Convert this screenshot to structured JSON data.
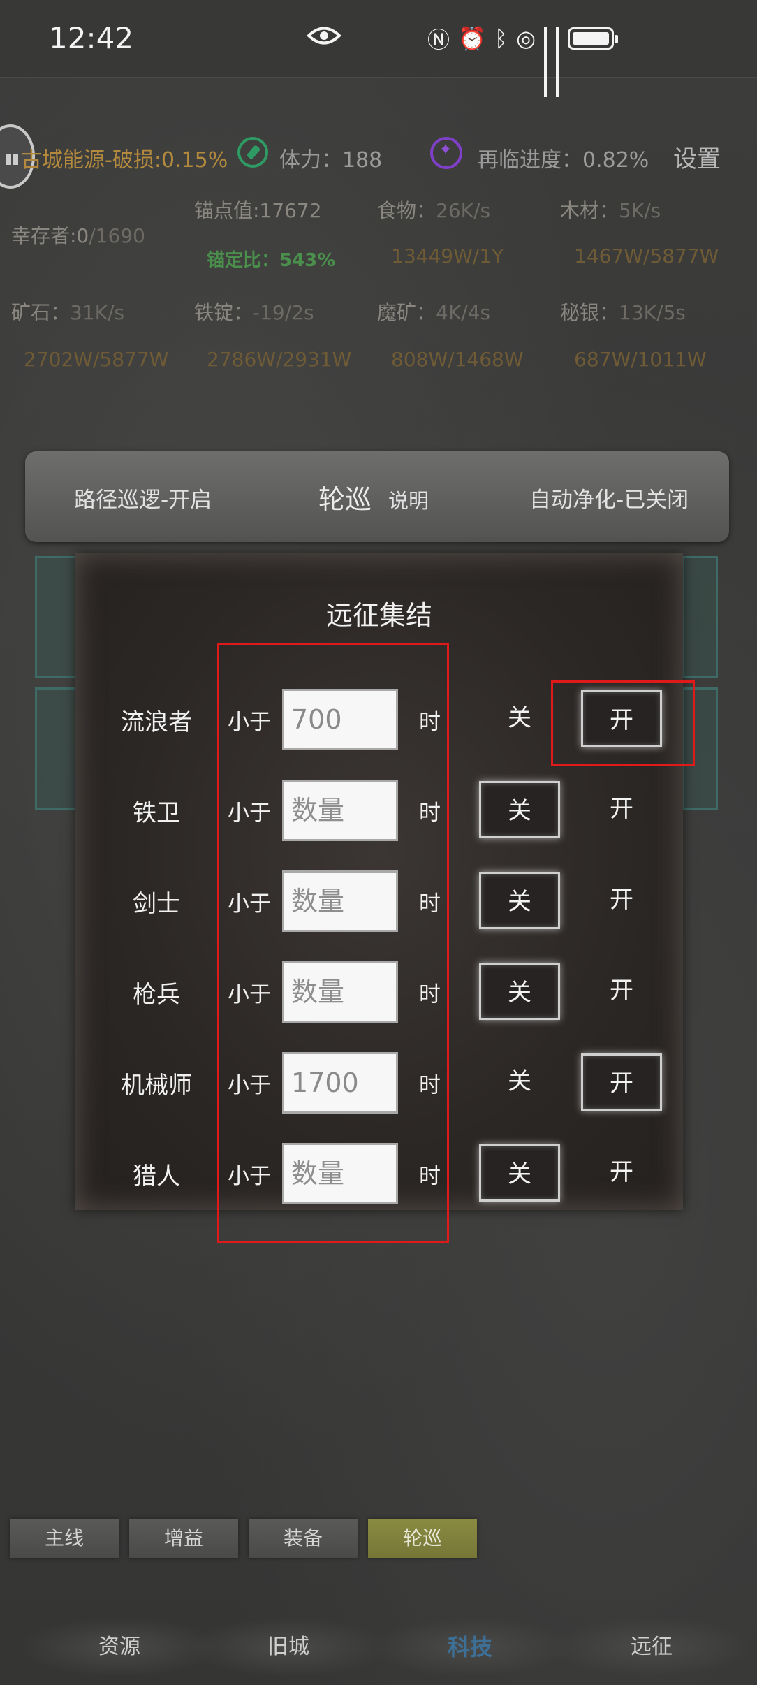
{
  "status_bar": {
    "time": "12:42",
    "icons": [
      "eye-icon",
      "nfc-icon",
      "alarm-icon",
      "bluetooth-icon",
      "hotspot-icon",
      "signal-icon",
      "signal-icon",
      "battery-icon"
    ]
  },
  "stats": {
    "energy": "古城能源-破损:0.15%",
    "stamina_label": "体力：",
    "stamina_value": "188",
    "progress_label": "再临进度：",
    "progress_value": "0.82%",
    "settings": "设置",
    "survivors_label": "幸存者:0",
    "survivors_max": "/1690",
    "anchor": "锚点值:17672",
    "anchor_ratio": "锚定比：543%",
    "food_label": "食物：",
    "food_rate": "26K/s",
    "food_total": "13449W/1Y",
    "wood_label": "木材：",
    "wood_rate": "5K/s",
    "wood_total": "1467W/5877W",
    "ore_label": "矿石：",
    "ore_rate": "31K/s",
    "ore_total": "2702W/5877W",
    "ingot_label": "铁锭：",
    "ingot_rate": "-19/2s",
    "ingot_total": "2786W/2931W",
    "magic_label": "魔矿：",
    "magic_rate": "4K/4s",
    "magic_total": "808W/1468W",
    "mithril_label": "秘银：",
    "mithril_rate": "13K/5s",
    "mithril_total": "687W/1011W"
  },
  "patrol_bar": {
    "path": "路径巡逻-开启",
    "title": "轮巡",
    "help": "说明",
    "auto_purify": "自动净化-已关闭"
  },
  "dialog": {
    "title": "远征集结",
    "less_than": "小于",
    "when": "时",
    "off_label": "关",
    "on_label": "开",
    "placeholder": "数量",
    "rows": [
      {
        "unit": "流浪者",
        "value": "700",
        "state": "on"
      },
      {
        "unit": "铁卫",
        "value": "",
        "state": "off"
      },
      {
        "unit": "剑士",
        "value": "",
        "state": "off"
      },
      {
        "unit": "枪兵",
        "value": "",
        "state": "off"
      },
      {
        "unit": "机械师",
        "value": "1700",
        "state": "on"
      },
      {
        "unit": "猎人",
        "value": "",
        "state": "off"
      }
    ]
  },
  "sub_tabs": [
    "主线",
    "增益",
    "装备",
    "轮巡"
  ],
  "sub_tab_selected": "轮巡",
  "nav": [
    "资源",
    "旧城",
    "科技",
    "远征"
  ],
  "nav_selected": "科技",
  "colors": {
    "accent_green": "#4a8f4c",
    "gold": "#b38a3d",
    "highlight_red": "#e0191a",
    "nav_selected": "#3d6f97",
    "subtab_selected": "#8a8b42"
  }
}
